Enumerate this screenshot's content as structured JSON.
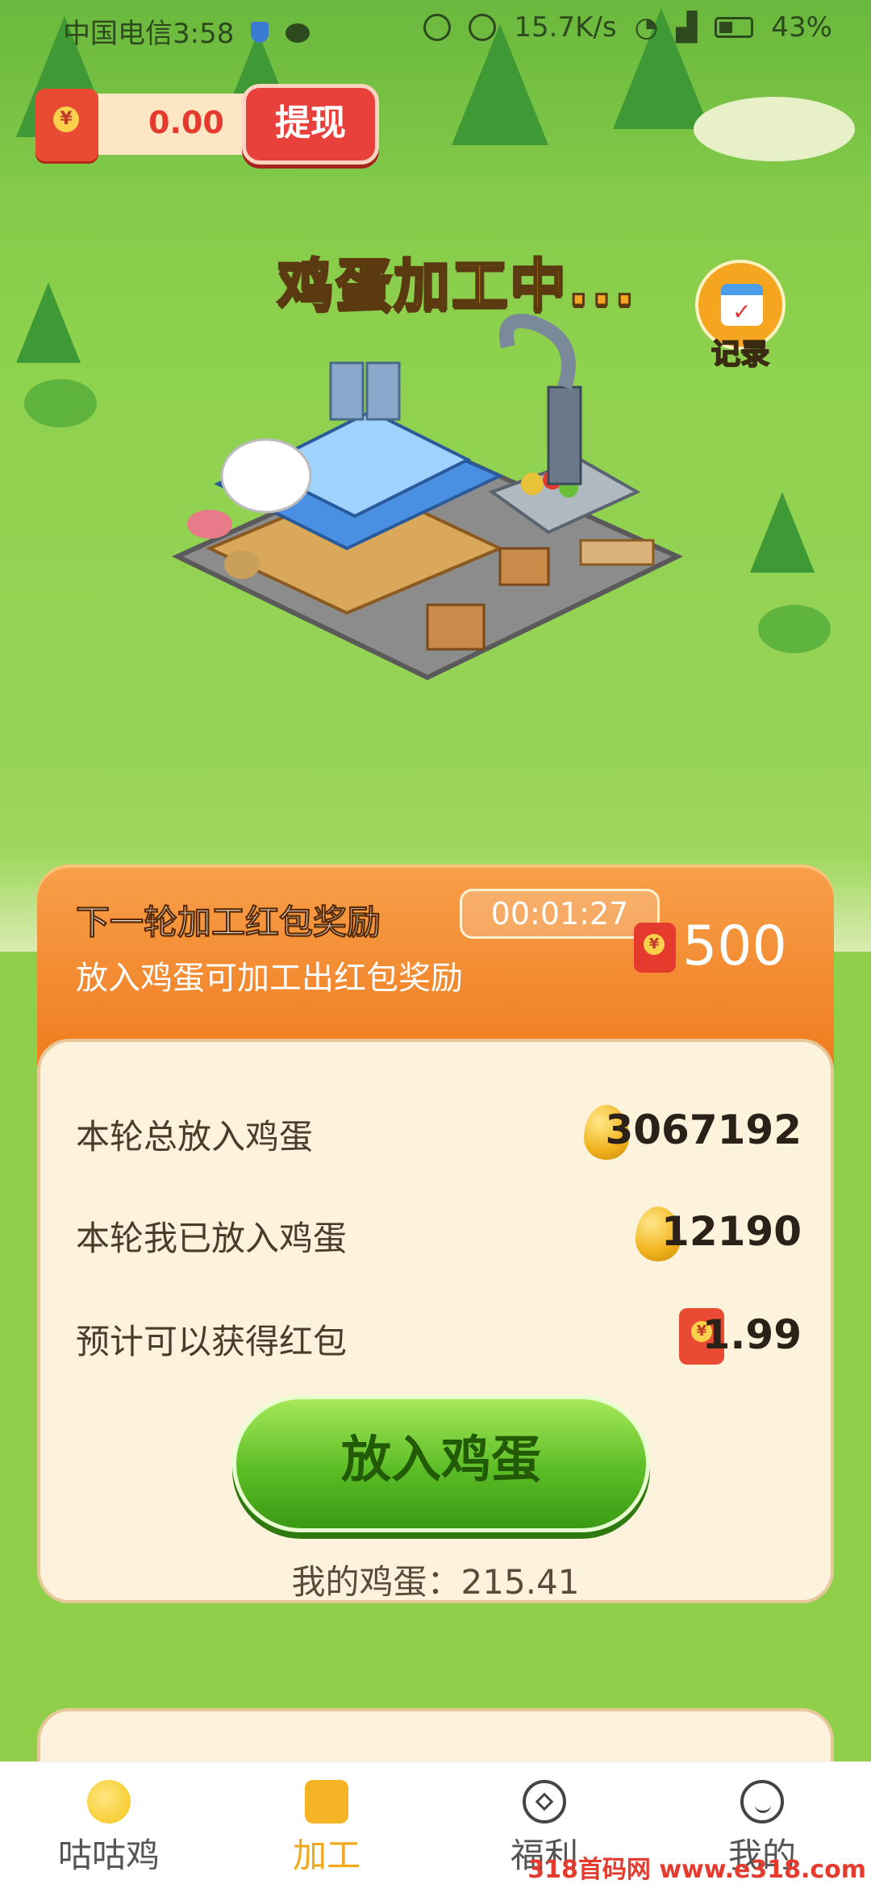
{
  "status_bar": {
    "carrier_time": "中国电信3:58",
    "network_speed": "15.7K/s",
    "battery": "43%"
  },
  "wallet": {
    "balance": "0.00",
    "withdraw_label": "提现"
  },
  "processing_title": "鸡蛋加工中...",
  "record_label": "记录",
  "reward": {
    "title": "下一轮加工红包奖励",
    "countdown": "00:01:27",
    "subtitle": "放入鸡蛋可加工出红包奖励",
    "amount": "500"
  },
  "stats": {
    "rows": [
      {
        "label": "本轮总放入鸡蛋",
        "value": "3067192",
        "icon": "egg-icon"
      },
      {
        "label": "本轮我已放入鸡蛋",
        "value": "12190",
        "icon": "egg-icon"
      },
      {
        "label": "预计可以获得红包",
        "value": "1.99",
        "icon": "red-envelope-icon"
      }
    ],
    "put_button_label": "放入鸡蛋",
    "my_eggs": "我的鸡蛋：215.41"
  },
  "tabs": [
    {
      "label": "咕咕鸡",
      "icon": "chick-icon",
      "active": false
    },
    {
      "label": "加工",
      "icon": "process-icon",
      "active": true
    },
    {
      "label": "福利",
      "icon": "welfare-icon",
      "active": false
    },
    {
      "label": "我的",
      "icon": "profile-icon",
      "active": false
    }
  ],
  "watermark": "318首码网 www.e318.com",
  "colors": {
    "accent_orange": "#f07b1f",
    "button_green": "#5bbd25",
    "red_envelope": "#e84b32",
    "active_tab": "#f2a81b"
  }
}
